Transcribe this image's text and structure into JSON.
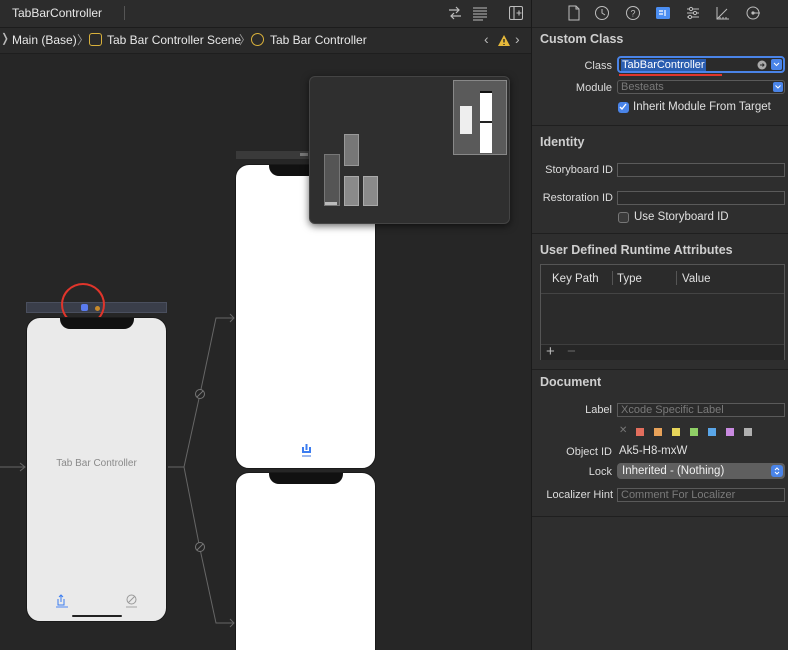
{
  "topbar": {
    "title": "TabBarController"
  },
  "breadcrumb": {
    "items": [
      "Main (Base)",
      "Tab Bar Controller Scene",
      "Tab Bar Controller"
    ]
  },
  "canvas": {
    "tab_bar_controller_label": "Tab Bar Controller"
  },
  "inspector": {
    "custom_class": {
      "title": "Custom Class",
      "class_label": "Class",
      "class_value": "TabBarController",
      "module_label": "Module",
      "module_placeholder": "Besteats",
      "inherit_label": "Inherit Module From Target"
    },
    "identity": {
      "title": "Identity",
      "storyboard_id_label": "Storyboard ID",
      "restoration_id_label": "Restoration ID",
      "use_storyboard_id_label": "Use Storyboard ID"
    },
    "runtime_attributes": {
      "title": "User Defined Runtime Attributes",
      "columns": [
        "Key Path",
        "Type",
        "Value"
      ],
      "add": "+",
      "remove": "−"
    },
    "document": {
      "title": "Document",
      "label_label": "Label",
      "label_placeholder": "Xcode Specific Label",
      "object_id_label": "Object ID",
      "object_id_value": "Ak5-H8-mxW",
      "lock_label": "Lock",
      "lock_value": "Inherited - (Nothing)",
      "localizer_label": "Localizer Hint",
      "localizer_placeholder": "Comment For Localizer",
      "clear_mark": "✕",
      "colors": [
        "#e36e5d",
        "#e8a259",
        "#e7d55a",
        "#8fcf66",
        "#5aa6e8",
        "#c98ae0",
        "#b0b0b0"
      ]
    }
  }
}
